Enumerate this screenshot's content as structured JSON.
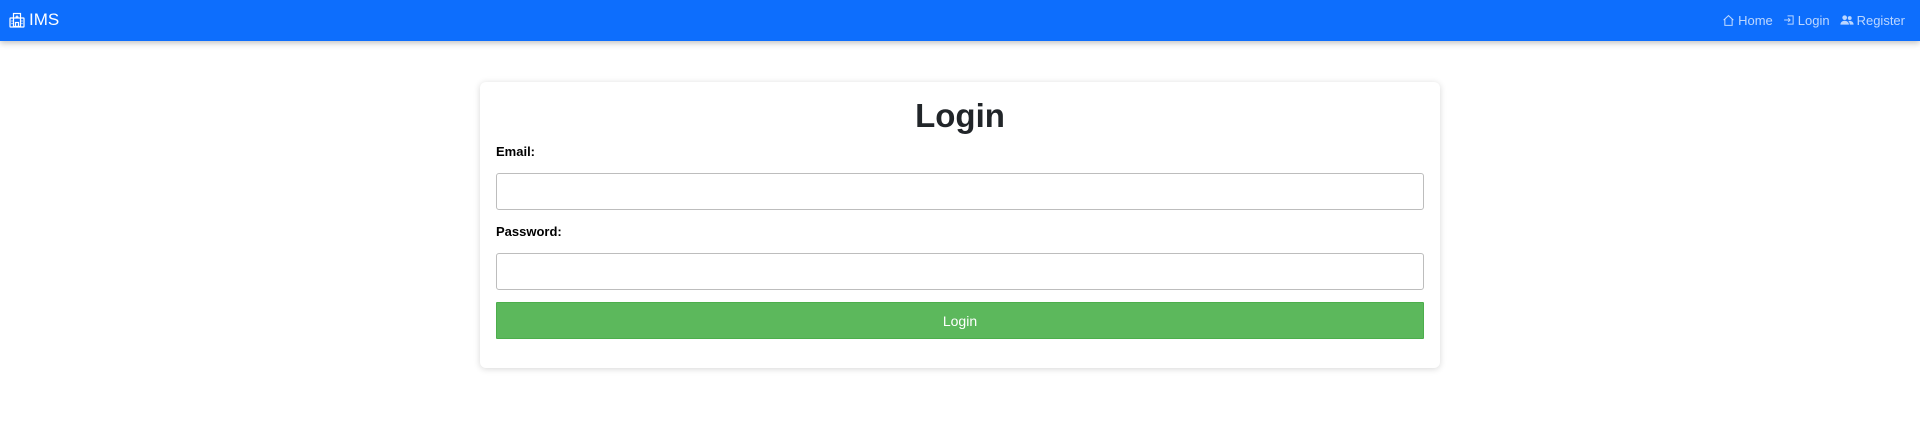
{
  "navbar": {
    "brand": {
      "icon": "hospital-icon",
      "label": "IMS"
    },
    "links": [
      {
        "icon": "house-icon",
        "label": "Home"
      },
      {
        "icon": "login-icon",
        "label": "Login"
      },
      {
        "icon": "people-icon",
        "label": "Register"
      }
    ]
  },
  "login_form": {
    "title": "Login",
    "email_label": "Email:",
    "email_value": "",
    "password_label": "Password:",
    "password_value": "",
    "submit_label": "Login"
  },
  "colors": {
    "navbar_bg": "#0d6efd",
    "submit_bg": "#5cb85c"
  }
}
